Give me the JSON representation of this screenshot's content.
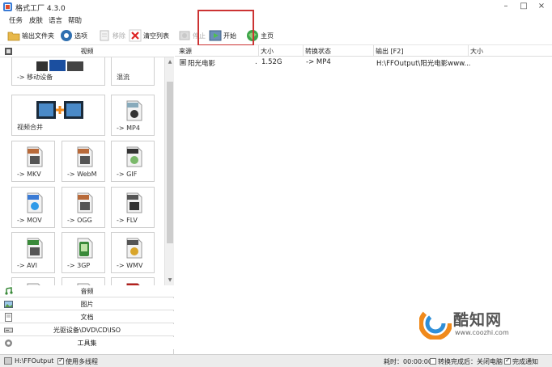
{
  "window": {
    "title": "格式工厂 4.3.0"
  },
  "menu": [
    "任务",
    "皮肤",
    "语言",
    "帮助"
  ],
  "toolbar": {
    "output_folder": "输出文件夹",
    "options": "选项",
    "remove": "移除",
    "clear_list": "清空列表",
    "stop": "停止",
    "start": "开始",
    "home": "主页"
  },
  "left": {
    "video_header": "视频",
    "tiles": {
      "mobile": "-> 移动设备",
      "mixed": "混流",
      "merge": "视频合并",
      "mp4": "-> MP4",
      "mkv": "-> MKV",
      "webm": "-> WebM",
      "gif": "-> GIF",
      "mov": "-> MOV",
      "ogg": "-> OGG",
      "flv": "-> FLV",
      "avi": "-> AVI",
      "3gp": "-> 3GP",
      "wmv": "-> WMV"
    },
    "categories": [
      "音频",
      "图片",
      "文档",
      "光驱设备\\DVD\\CD\\ISO",
      "工具集"
    ]
  },
  "table": {
    "columns": [
      "来源",
      "大小",
      "转换状态",
      "输出 [F2]",
      "大小"
    ],
    "rows": [
      {
        "source": "阳光电影",
        "dot": ".",
        "size": "1.52G",
        "status": "-> MP4",
        "output": "H:\\FFOutput\\阳光电影www..."
      }
    ]
  },
  "status": {
    "output_path": "H:\\FFOutput",
    "multithread": "使用多线程",
    "elapsed": "耗时：00:00:00",
    "shutdown": "转换完成后：关闭电脑",
    "notify": "完成通知"
  },
  "watermark": {
    "brand": "酷知网",
    "url": "www.coozhi.com"
  },
  "colors": {
    "accent": "#cc3333",
    "watermark_orange": "#f08a1c",
    "watermark_blue": "#2f8fd8"
  }
}
